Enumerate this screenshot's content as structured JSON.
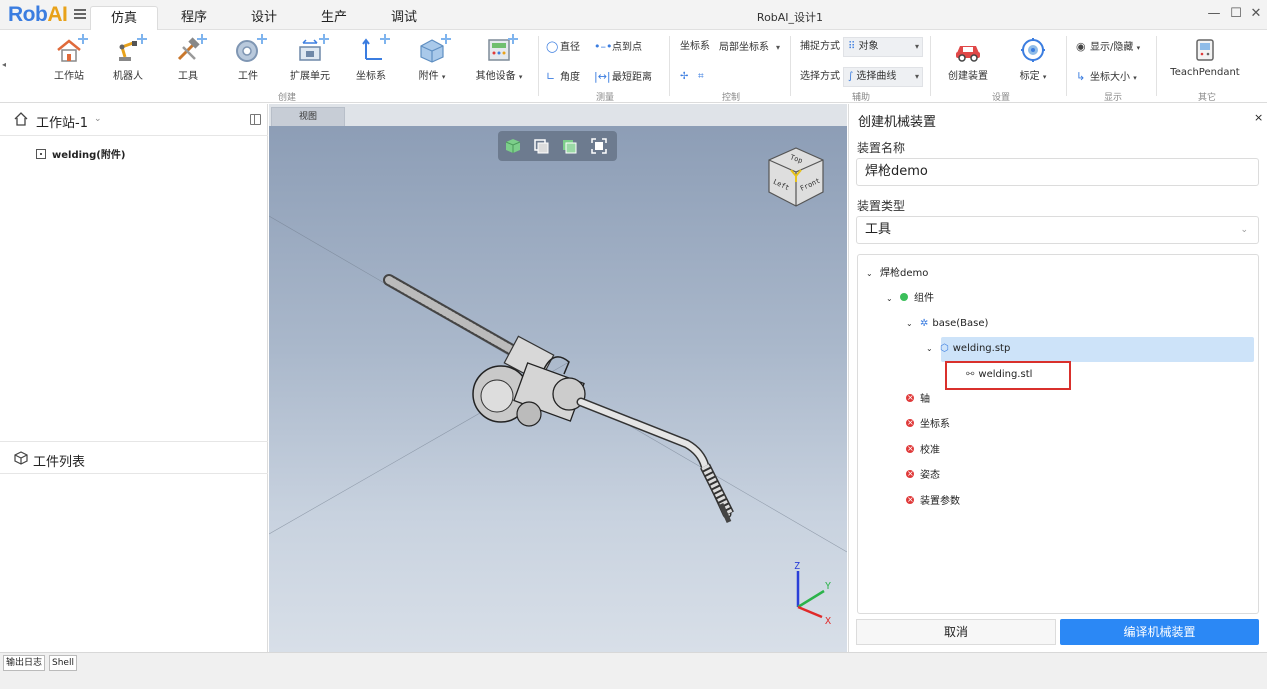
{
  "app": {
    "logo_main": "Rob",
    "logo_accent": "AI",
    "window_title": "RobAI_设计1"
  },
  "menu_tabs": [
    "仿真",
    "程序",
    "设计",
    "生产",
    "调试"
  ],
  "window_controls": {
    "minimize": "—",
    "maximize": "☐",
    "close": "✕"
  },
  "ribbon": {
    "create": {
      "group_label": "创建",
      "buttons": [
        "工作站",
        "机器人",
        "工具",
        "工件",
        "扩展单元",
        "坐标系",
        "附件",
        "其他设备"
      ]
    },
    "measure": {
      "group_label": "测量",
      "items": [
        "直径",
        "点到点",
        "角度",
        "最短距离"
      ]
    },
    "control": {
      "group_label": "控制",
      "coord_label": "坐标系",
      "coord_value": "局部坐标系"
    },
    "assist": {
      "group_label": "辅助",
      "snap_label": "捕捉方式",
      "snap_value": "对象",
      "select_label": "选择方式",
      "select_value": "选择曲线"
    },
    "settings": {
      "group_label": "设置",
      "buttons": [
        "创建装置",
        "标定"
      ]
    },
    "display": {
      "group_label": "显示",
      "items": [
        "显示/隐藏",
        "坐标大小"
      ]
    },
    "other": {
      "group_label": "其它",
      "buttons": [
        "TeachPendant"
      ]
    }
  },
  "left_panel": {
    "workstation_title": "工作站-1",
    "tree_item": "welding(附件)",
    "workpiece_list_title": "工件列表"
  },
  "viewport": {
    "tab_label": "视图",
    "navcube_faces": [
      "Top",
      "Left",
      "Front"
    ],
    "axes": [
      "Z",
      "Y",
      "X"
    ]
  },
  "right_panel": {
    "title": "创建机械装置",
    "close": "×",
    "name_label": "装置名称",
    "name_value": "焊枪demo",
    "type_label": "装置类型",
    "type_value": "工具",
    "tree": {
      "root": "焊枪demo",
      "components": "组件",
      "base": "base(Base)",
      "stp_file": "welding.stp",
      "stl_file": "welding.stl",
      "axis": "轴",
      "coord": "坐标系",
      "calibration": "校准",
      "pose": "姿态",
      "params": "装置参数"
    },
    "cancel_button": "取消",
    "compile_button": "编译机械装置"
  },
  "bottom_tabs": [
    "输出日志",
    "Shell"
  ],
  "colors": {
    "brand_blue": "#3b7de0",
    "brand_orange": "#e8a21a",
    "primary_button": "#2b88f5",
    "selection": "#cde3f9",
    "highlight_box": "#d9302c",
    "status_green": "#3bbf5a",
    "status_red": "#e03a3a"
  }
}
